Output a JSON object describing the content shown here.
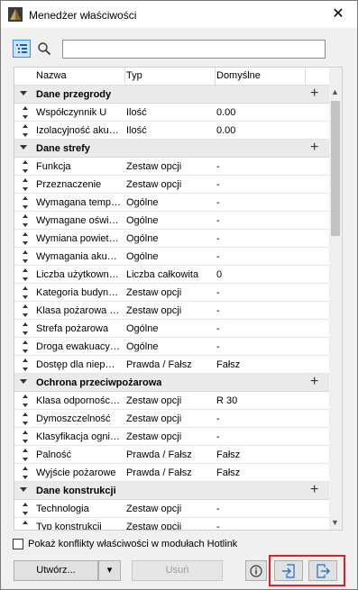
{
  "window": {
    "title": "Menedżer właściwości"
  },
  "search": {
    "value": "",
    "placeholder": ""
  },
  "columns": {
    "name": "Nazwa",
    "type": "Typ",
    "default": "Domyślne"
  },
  "groups": [
    {
      "label": "Dane przegrody",
      "rows": [
        {
          "name": "Współczynnik U",
          "type": "Ilość",
          "default": "0.00"
        },
        {
          "name": "Izolacyjność aku…",
          "type": "Ilość",
          "default": "0.00"
        }
      ]
    },
    {
      "label": "Dane strefy",
      "rows": [
        {
          "name": "Funkcja",
          "type": "Zestaw opcji",
          "default": "-"
        },
        {
          "name": "Przeznaczenie",
          "type": "Zestaw opcji",
          "default": "-"
        },
        {
          "name": "Wymagana temp…",
          "type": "Ogólne",
          "default": "-"
        },
        {
          "name": "Wymagane oświ…",
          "type": "Ogólne",
          "default": "-"
        },
        {
          "name": "Wymiana powiet…",
          "type": "Ogólne",
          "default": "-"
        },
        {
          "name": "Wymagania aku…",
          "type": "Ogólne",
          "default": "-"
        },
        {
          "name": "Liczba użytkown…",
          "type": "Liczba całkowita",
          "default": "0"
        },
        {
          "name": "Kategoria budyn…",
          "type": "Zestaw opcji",
          "default": "-"
        },
        {
          "name": "Klasa pożarowa …",
          "type": "Zestaw opcji",
          "default": "-"
        },
        {
          "name": "Strefa pożarowa",
          "type": "Ogólne",
          "default": "-"
        },
        {
          "name": "Droga ewakuacy…",
          "type": "Ogólne",
          "default": "-"
        },
        {
          "name": "Dostęp dla niep…",
          "type": "Prawda / Fałsz",
          "default": "Fałsz"
        }
      ]
    },
    {
      "label": "Ochrona przeciwpożarowa",
      "rows": [
        {
          "name": "Klasa odpornośc…",
          "type": "Zestaw opcji",
          "default": "R 30"
        },
        {
          "name": "Dymoszczelność",
          "type": "Zestaw opcji",
          "default": "-"
        },
        {
          "name": "Klasyfikacja ogni…",
          "type": "Zestaw opcji",
          "default": "-"
        },
        {
          "name": "Palność",
          "type": "Prawda / Fałsz",
          "default": "Fałsz"
        },
        {
          "name": "Wyjście pożarowe",
          "type": "Prawda / Fałsz",
          "default": "Fałsz"
        }
      ]
    },
    {
      "label": "Dane konstrukcji",
      "rows": [
        {
          "name": "Technologia",
          "type": "Zestaw opcji",
          "default": "-"
        },
        {
          "name": "Typ konstrukcji",
          "type": "Zestaw opcji",
          "default": "-"
        }
      ]
    }
  ],
  "hotlink": {
    "label": "Pokaż konflikty właściwości w modułach Hotlink",
    "checked": false
  },
  "buttons": {
    "create": "Utwórz...",
    "delete": "Usuń"
  },
  "icons": {
    "app": "archicad-icon",
    "close": "close-icon",
    "tree": "tree-view-icon",
    "search": "search-icon",
    "info": "info-icon",
    "import": "import-icon",
    "export": "export-icon"
  },
  "colors": {
    "highlight": "#e02020",
    "tree_active": "#cde3fa"
  }
}
